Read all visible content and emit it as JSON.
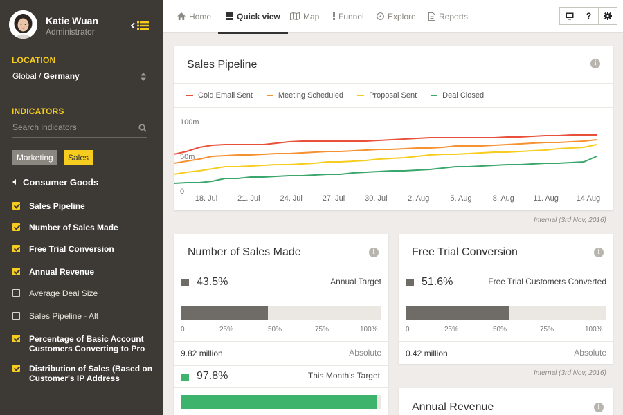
{
  "user": {
    "name": "Katie Wuan",
    "role": "Administrator"
  },
  "sidebar": {
    "location_label": "LOCATION",
    "location_global": "Global",
    "location_sep": " / ",
    "location_country": "Germany",
    "indicators_label": "INDICATORS",
    "search_placeholder": "Search indicators",
    "tags": [
      "Marketing",
      "Sales"
    ],
    "category": "Consumer Goods",
    "indicators": [
      {
        "label": "Sales Pipeline",
        "checked": true
      },
      {
        "label": "Number of Sales Made",
        "checked": true
      },
      {
        "label": "Free Trial Conversion",
        "checked": true
      },
      {
        "label": "Annual Revenue",
        "checked": true
      },
      {
        "label": "Average Deal Size",
        "checked": false
      },
      {
        "label": "Sales Pipeline - Alt",
        "checked": false
      },
      {
        "label": "Percentage of Basic Account Customers Converting to Pro",
        "checked": true
      },
      {
        "label": "Distribution of Sales (Based on Customer's IP Address",
        "checked": true
      }
    ]
  },
  "nav": {
    "items": [
      "Home",
      "Quick view",
      "Map",
      "Funnel",
      "Explore",
      "Reports"
    ],
    "active": "Quick view",
    "tools": [
      "monitor-icon",
      "?",
      "gear-icon"
    ]
  },
  "pipeline": {
    "title": "Sales Pipeline",
    "footnote": "Internal (3rd Nov, 2016)"
  },
  "chart_data": {
    "type": "line",
    "title": "Sales Pipeline",
    "x": [
      "18. Jul",
      "21. Jul",
      "24. Jul",
      "27. Jul",
      "30. Jul",
      "2. Aug",
      "5. Aug",
      "8. Aug",
      "11. Aug",
      "14 Aug"
    ],
    "y_ticks": [
      "100m",
      "50m",
      "0"
    ],
    "ylim": [
      0,
      100
    ],
    "legend_position": "top",
    "grid": false,
    "series": [
      {
        "name": "Cold Email Sent",
        "color": "#e8503a",
        "values": [
          53,
          57,
          63,
          66,
          67,
          67,
          67,
          67,
          69,
          71,
          72,
          72,
          72,
          72,
          72,
          72,
          73,
          74,
          75,
          76,
          77,
          77,
          77,
          77,
          77,
          77,
          78,
          78,
          79,
          80,
          80,
          81,
          81,
          81
        ]
      },
      {
        "name": "Meeting Scheduled",
        "color": "#f59130",
        "values": [
          40,
          43,
          46,
          50,
          51,
          52,
          52,
          53,
          54,
          54,
          55,
          56,
          57,
          57,
          58,
          59,
          60,
          60,
          61,
          62,
          62,
          63,
          65,
          65,
          65,
          66,
          67,
          68,
          69,
          70,
          70,
          71,
          72,
          74
        ]
      },
      {
        "name": "Proposal Sent",
        "color": "#f6cd1e",
        "values": [
          24,
          27,
          29,
          32,
          35,
          35,
          36,
          37,
          38,
          38,
          39,
          40,
          42,
          42,
          43,
          44,
          46,
          47,
          48,
          50,
          52,
          53,
          53,
          54,
          55,
          56,
          56,
          57,
          58,
          59,
          61,
          62,
          63,
          67
        ]
      },
      {
        "name": "Deal Closed",
        "color": "#3aa66b",
        "values": [
          11,
          12,
          12,
          14,
          18,
          18,
          20,
          20,
          21,
          22,
          22,
          23,
          24,
          24,
          26,
          27,
          28,
          29,
          29,
          30,
          31,
          33,
          35,
          35,
          36,
          37,
          38,
          38,
          39,
          40,
          40,
          41,
          42,
          50
        ]
      }
    ]
  },
  "sales_made": {
    "title": "Number of Sales Made",
    "stat1": {
      "pct": "43.5%",
      "target": "Annual Target",
      "value": 43.5,
      "color": "#6f6b66"
    },
    "scale": [
      "0",
      "25%",
      "50%",
      "75%",
      "100%"
    ],
    "absolute_value": "9.82 million",
    "absolute_label": "Absolute",
    "stat2": {
      "pct": "97.8%",
      "target": "This Month's Target",
      "value": 97.8,
      "color": "#3db36b"
    }
  },
  "free_trial": {
    "title": "Free Trial Conversion",
    "stat1": {
      "pct": "51.6%",
      "target": "Free Trial Customers Converted",
      "value": 51.6,
      "color": "#6f6b66"
    },
    "scale": [
      "0",
      "25%",
      "50%",
      "75%",
      "100%"
    ],
    "absolute_value": "0.42 million",
    "absolute_label": "Absolute",
    "footnote": "Internal (3rd Nov, 2016)"
  },
  "annual_revenue": {
    "title": "Annual Revenue"
  },
  "colors": {
    "accent": "#f6cd1e",
    "sidebar": "#3d3a36",
    "bar": "#6f6b66",
    "good": "#3db36b"
  }
}
